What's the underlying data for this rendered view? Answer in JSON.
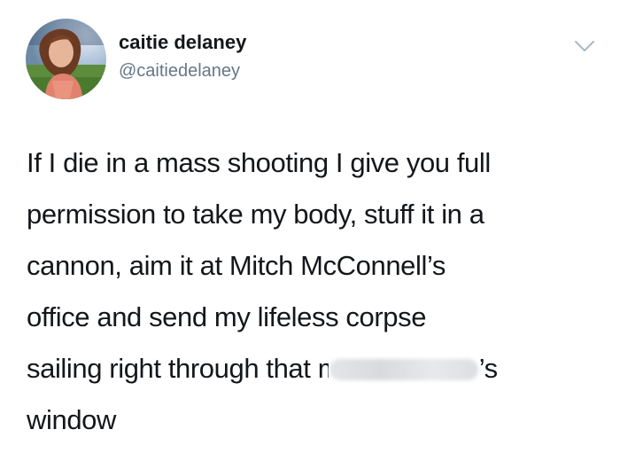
{
  "tweet": {
    "author": {
      "display_name": "caitie delaney",
      "handle": "@caitiedelaney"
    },
    "menu_icon": "chevron-down-icon",
    "text_lines": [
      "If I die in a mass shooting I give you full",
      "permission to take my body, stuff it in a",
      "cannon, aim it at Mitch McConnell’s",
      "office and send my lifeless corpse"
    ],
    "line5": {
      "before": "sailing right through that ",
      "partial": "m",
      "after": "’s"
    },
    "line6": "window"
  },
  "colors": {
    "text": "#14171a",
    "secondary_text": "#657786",
    "background": "#ffffff"
  }
}
